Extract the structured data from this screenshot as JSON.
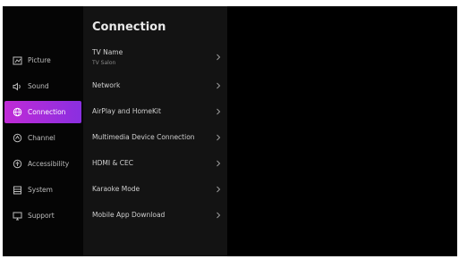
{
  "sidebar": {
    "items": [
      {
        "label": "Picture",
        "icon": "picture-icon"
      },
      {
        "label": "Sound",
        "icon": "sound-icon"
      },
      {
        "label": "Connection",
        "icon": "connection-icon",
        "selected": true
      },
      {
        "label": "Channel",
        "icon": "channel-icon"
      },
      {
        "label": "Accessibility",
        "icon": "accessibility-icon"
      },
      {
        "label": "System",
        "icon": "system-icon"
      },
      {
        "label": "Support",
        "icon": "support-icon"
      }
    ]
  },
  "panel": {
    "title": "Connection",
    "rows": [
      {
        "label": "TV Name",
        "value": "TV Salon"
      },
      {
        "label": "Network"
      },
      {
        "label": "AirPlay and HomeKit"
      },
      {
        "label": "Multimedia Device Connection"
      },
      {
        "label": "HDMI & CEC"
      },
      {
        "label": "Karaoke Mode"
      },
      {
        "label": "Mobile App Download"
      }
    ]
  },
  "colors": {
    "accent_start": "#c02bd6",
    "accent_end": "#8a2fe0",
    "panel_bg": "#131313",
    "screen_bg": "#000000"
  }
}
